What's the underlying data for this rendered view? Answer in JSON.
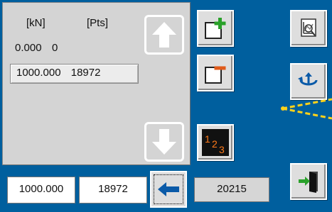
{
  "list": {
    "header": {
      "force_unit": "[kN]",
      "points_unit": "[Pts]"
    },
    "rows": [
      {
        "force": "0.000",
        "points": "0"
      },
      {
        "force": "1000.000",
        "points": "18972"
      }
    ]
  },
  "bottom": {
    "force_value": "1000.000",
    "points_value": "18972",
    "total_points": "20215"
  },
  "colors": {
    "background": "#005f9e",
    "add_icon": "#2aa12a",
    "remove_icon": "#e05a1a",
    "sequence_icon": "#ff7a1a",
    "back_arrow": "#0a5aa8",
    "callout_line": "#ffd21a"
  },
  "icons": {
    "scroll_up": "arrow-up-icon",
    "scroll_down": "arrow-down-icon",
    "add": "add-row-icon",
    "remove": "remove-row-icon",
    "renumber": "renumber-icon",
    "back": "arrow-left-icon",
    "zoom": "chart-zoom-icon",
    "rotate": "rotate-icon",
    "exit": "exit-door-icon"
  }
}
